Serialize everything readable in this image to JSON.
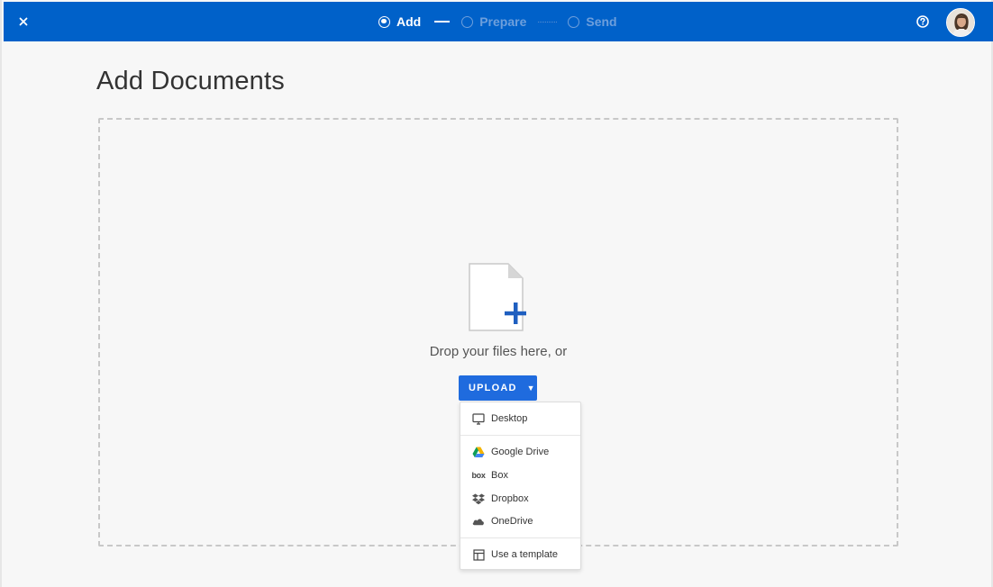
{
  "header": {
    "steps": [
      {
        "label": "Add",
        "state": "active"
      },
      {
        "label": "Prepare",
        "state": "inactive"
      },
      {
        "label": "Send",
        "state": "inactive"
      }
    ],
    "colors": {
      "bar": "#0061c9",
      "active": "#ffffff",
      "inactive": "#6d9fdc"
    }
  },
  "page": {
    "title": "Add Documents",
    "drop_text": "Drop your files here, or"
  },
  "upload": {
    "label": "UPLOAD",
    "accent": "#1f6bde"
  },
  "menu": {
    "items": [
      {
        "label": "Desktop",
        "icon": "monitor-icon"
      },
      {
        "label": "Google Drive",
        "icon": "google-drive-icon"
      },
      {
        "label": "Box",
        "icon": "box-logo-icon"
      },
      {
        "label": "Dropbox",
        "icon": "dropbox-icon"
      },
      {
        "label": "OneDrive",
        "icon": "onedrive-icon"
      },
      {
        "label": "Use a template",
        "icon": "template-icon"
      }
    ]
  }
}
